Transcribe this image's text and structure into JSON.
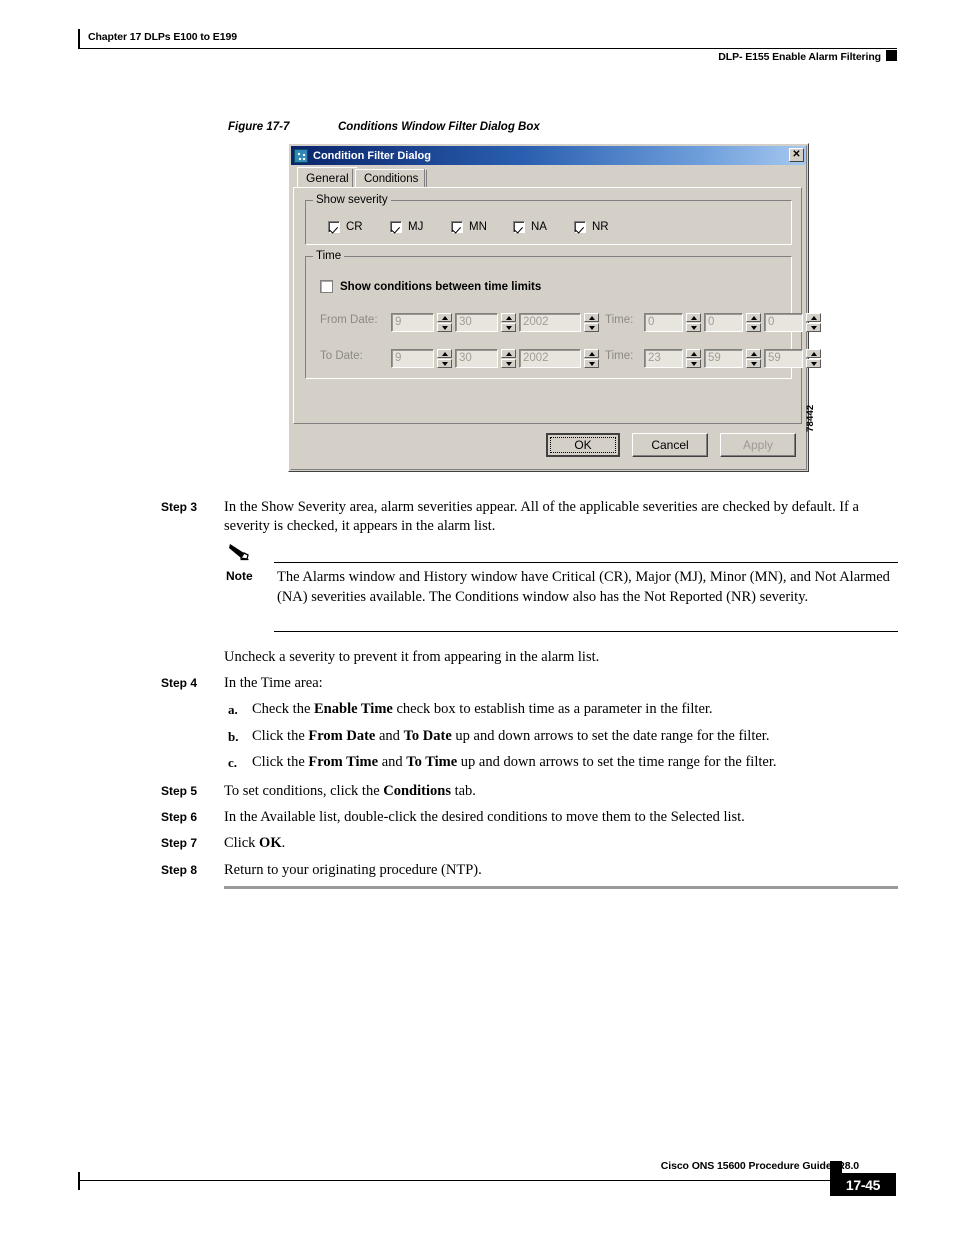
{
  "header": {
    "chapter": "Chapter 17 DLPs E100 to E199",
    "section": "DLP- E155 Enable Alarm Filtering"
  },
  "figure": {
    "number": "Figure 17-7",
    "title": "Conditions Window Filter Dialog Box",
    "figure_id": "78442"
  },
  "dialog": {
    "title": "Condition Filter Dialog",
    "close_label": "✕",
    "tabs": [
      {
        "label": "General",
        "active": true
      },
      {
        "label": "Conditions",
        "active": false
      }
    ],
    "severity_group": {
      "title": "Show severity",
      "checkboxes": [
        {
          "label": "CR",
          "checked": true
        },
        {
          "label": "MJ",
          "checked": true
        },
        {
          "label": "MN",
          "checked": true
        },
        {
          "label": "NA",
          "checked": true
        },
        {
          "label": "NR",
          "checked": true
        }
      ]
    },
    "time_group": {
      "title": "Time",
      "enable_label": "Show conditions between time limits",
      "enable_checked": false,
      "rows": [
        {
          "date_label": "From Date:",
          "time_label": "Time:",
          "month": "9",
          "day": "30",
          "year": "2002",
          "hour": "0",
          "minute": "0",
          "second": "0"
        },
        {
          "date_label": "To Date:",
          "time_label": "Time:",
          "month": "9",
          "day": "30",
          "year": "2002",
          "hour": "23",
          "minute": "59",
          "second": "59"
        }
      ]
    },
    "buttons": {
      "ok": "OK",
      "cancel": "Cancel",
      "apply": "Apply"
    }
  },
  "steps": {
    "step3_label": "Step 3",
    "step3_text": "In the Show Severity area, alarm severities appear. All of the applicable severities are checked by default. If a severity is checked, it appears in the alarm list.",
    "note_label": "Note",
    "note_text": "The Alarms window and History window have Critical (CR), Major (MJ), Minor (MN), and Not Alarmed (NA) severities available. The Conditions window also has the Not Reported (NR) severity.",
    "uncheck_text": "Uncheck a severity to prevent it from appearing in the alarm list.",
    "step4_label": "Step 4",
    "step4_text": "In the Time area:",
    "step4a_label": "a.",
    "step4a_pre": "Check the ",
    "step4a_bold": "Enable Time",
    "step4a_post": " check box to establish time as a parameter in the filter.",
    "step4b_label": "b.",
    "step4b_pre": "Click the ",
    "step4b_bold1": "From Date",
    "step4b_mid": " and ",
    "step4b_bold2": "To Date",
    "step4b_post": " up and down arrows to set the date range for the filter.",
    "step4c_label": "c.",
    "step4c_pre": "Click the ",
    "step4c_bold1": "From Time",
    "step4c_mid": " and ",
    "step4c_bold2": "To Time",
    "step4c_post": " up and down arrows to set the time range for the filter.",
    "step5_label": "Step 5",
    "step5_pre": "To set conditions, click the ",
    "step5_bold": "Conditions",
    "step5_post": " tab.",
    "step6_label": "Step 6",
    "step6_text": "In the Available list, double-click the desired conditions to move them to the Selected list.",
    "step7_label": "Step 7",
    "step7_pre": "Click ",
    "step7_bold": "OK",
    "step7_post": ".",
    "step8_label": "Step 8",
    "step8_text": "Return to your originating procedure (NTP)."
  },
  "footer": {
    "guide": "Cisco ONS 15600 Procedure Guide, R8.0",
    "page": "17-45"
  }
}
